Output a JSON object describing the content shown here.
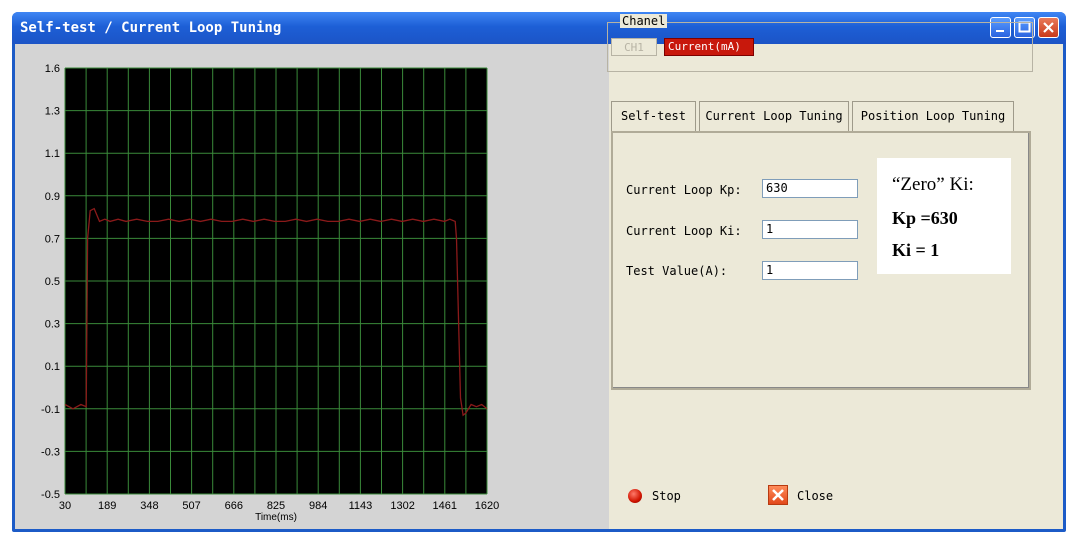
{
  "window": {
    "title": "Self-test / Current Loop Tuning"
  },
  "channel": {
    "group_label": "Chanel",
    "ch1_label": "CH1",
    "current_label": "Current(mA)"
  },
  "tabs": [
    {
      "label": "Self-test"
    },
    {
      "label": "Current Loop Tuning"
    },
    {
      "label": "Position Loop Tuning"
    }
  ],
  "fields": {
    "kp_label": "Current Loop Kp:",
    "kp_value": "630",
    "ki_label": "Current Loop Ki:",
    "ki_value": "1",
    "test_label": "Test Value(A):",
    "test_value": "1"
  },
  "note": {
    "line1": "“Zero” Ki:",
    "line2": "Kp =630",
    "line3": "Ki = 1"
  },
  "actions": {
    "stop_label": "Stop",
    "close_label": "Close"
  },
  "colors": {
    "plot_background": "#000000",
    "grid": "#3a8a3a",
    "trace": "#8b1a1a",
    "channel_active": "#c8180c"
  },
  "chart_data": {
    "type": "line",
    "xlabel": "Time(ms)",
    "ylabel": "",
    "x_ticks": [
      "30",
      "189",
      "348",
      "507",
      "666",
      "825",
      "984",
      "1143",
      "1302",
      "1461",
      "1620"
    ],
    "y_ticks": [
      "1.6",
      "1.3",
      "1.1",
      "0.9",
      "0.7",
      "0.5",
      "0.3",
      "0.1",
      "-0.1",
      "-0.3",
      "-0.5"
    ],
    "xlim": [
      30,
      1620
    ],
    "ylim": [
      -0.5,
      1.6
    ],
    "grid": true,
    "series": [
      {
        "x": [
          30,
          60,
          90,
          110,
          115,
          125,
          140,
          160,
          180,
          200,
          230,
          260,
          300,
          340,
          380,
          420,
          460,
          500,
          540,
          580,
          620,
          660,
          700,
          740,
          780,
          820,
          860,
          900,
          940,
          980,
          1020,
          1060,
          1100,
          1140,
          1180,
          1220,
          1260,
          1300,
          1340,
          1380,
          1420,
          1460,
          1480,
          1500,
          1505,
          1520,
          1530,
          1540,
          1560,
          1580,
          1600,
          1620
        ],
        "y": [
          -0.08,
          -0.1,
          -0.08,
          -0.09,
          0.7,
          0.83,
          0.84,
          0.78,
          0.79,
          0.78,
          0.79,
          0.78,
          0.79,
          0.78,
          0.78,
          0.79,
          0.78,
          0.79,
          0.78,
          0.79,
          0.78,
          0.78,
          0.79,
          0.78,
          0.79,
          0.78,
          0.78,
          0.79,
          0.78,
          0.79,
          0.78,
          0.78,
          0.79,
          0.78,
          0.79,
          0.78,
          0.79,
          0.78,
          0.79,
          0.78,
          0.79,
          0.78,
          0.79,
          0.78,
          0.7,
          -0.05,
          -0.13,
          -0.12,
          -0.08,
          -0.09,
          -0.08,
          -0.1
        ]
      }
    ]
  }
}
